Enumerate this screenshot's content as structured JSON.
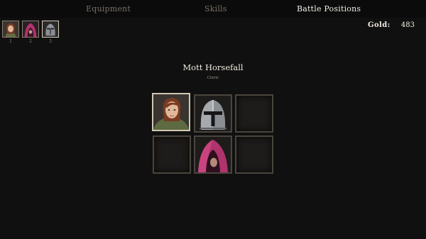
{
  "tabs": {
    "equipment": "Equipment",
    "skills": "Skills",
    "battle_positions": "Battle Positions"
  },
  "active_tab": "battle_positions",
  "party": [
    {
      "number": "1",
      "portrait": "woman-portrait-icon",
      "selected": false
    },
    {
      "number": "2",
      "portrait": "pink-hood-icon",
      "selected": false
    },
    {
      "number": "3",
      "portrait": "knight-helmet-icon",
      "selected": true
    }
  ],
  "gold": {
    "label": "Gold:",
    "value": "483"
  },
  "character": {
    "name": "Mott Horsefall",
    "class": "Cleric"
  },
  "formation": {
    "rows": [
      [
        "woman-portrait-icon",
        "knight-helmet-icon",
        "empty"
      ],
      [
        "empty",
        "pink-hood-icon",
        "empty"
      ]
    ],
    "selected_slot": "front-1"
  },
  "colors": {
    "background": "#101010",
    "text": "#f1ece2",
    "inactive_tab": "#777066",
    "slot_border": "#4b453e",
    "selected_border": "#cfc7b4",
    "hood": "#b0346c"
  }
}
